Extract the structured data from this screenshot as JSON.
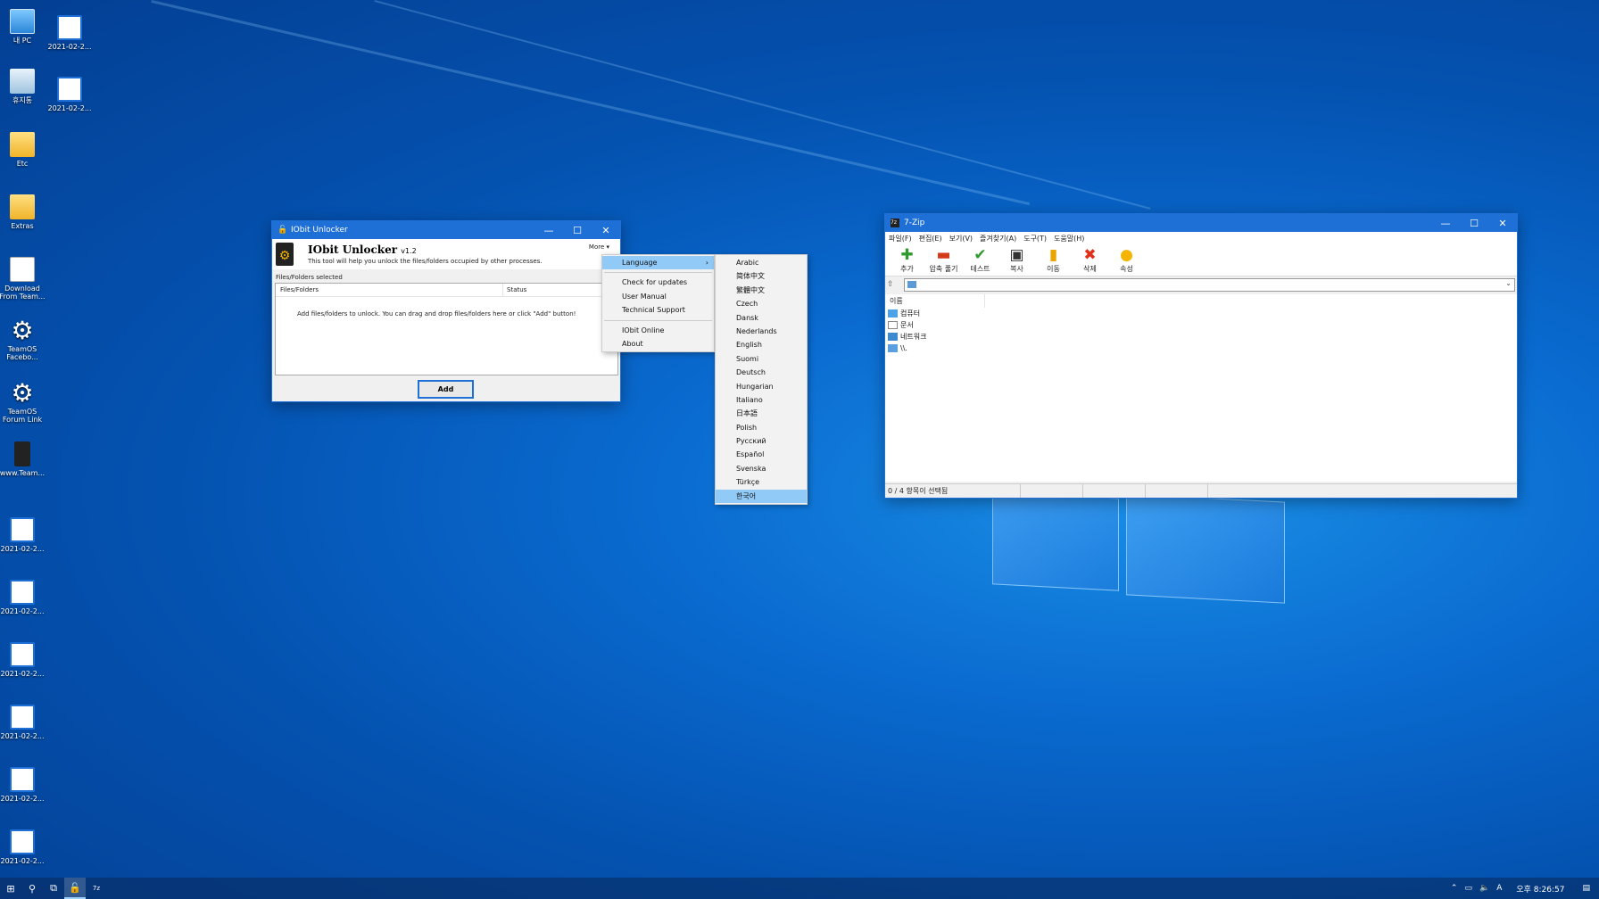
{
  "desktop": {
    "icons": [
      {
        "label": "내 PC",
        "glyph": "pc"
      },
      {
        "label": "2021-02-2...",
        "glyph": "img"
      },
      {
        "label": "휴지통",
        "glyph": "bin"
      },
      {
        "label": "2021-02-2...",
        "glyph": "img"
      },
      {
        "label": "Etc",
        "glyph": "folder"
      },
      {
        "label": "Extras",
        "glyph": "folder"
      },
      {
        "label": "Download From Team...",
        "glyph": "doc"
      },
      {
        "label": "TeamOS Facebo...",
        "glyph": "gear"
      },
      {
        "label": "TeamOS Forum Link",
        "glyph": "gear"
      },
      {
        "label": "www.Team...",
        "glyph": "dark"
      },
      {
        "label": "2021-02-2...",
        "glyph": "img"
      },
      {
        "label": "2021-02-2...",
        "glyph": "img"
      },
      {
        "label": "2021-02-2...",
        "glyph": "img"
      },
      {
        "label": "2021-02-2...",
        "glyph": "img"
      },
      {
        "label": "2021-02-2...",
        "glyph": "img"
      },
      {
        "label": "2021-02-2...",
        "glyph": "img"
      }
    ]
  },
  "iobit": {
    "title": "IObit Unlocker",
    "app_name": "IObit Unlocker",
    "version": "v1.2",
    "subtitle": "This tool will help you unlock the files/folders occupied by other processes.",
    "more_label": "More ▾",
    "selected_label": "Files/Folders selected",
    "col_files": "Files/Folders",
    "col_status": "Status",
    "hint": "Add files/folders to unlock. You can drag and drop files/folders here or click \"Add\" button!",
    "add_button": "Add"
  },
  "more_menu": {
    "language": "Language",
    "check_updates": "Check for updates",
    "user_manual": "User Manual",
    "tech_support": "Technical Support",
    "iobit_online": "IObit Online",
    "about": "About"
  },
  "language_menu": {
    "items": [
      "Arabic",
      "简体中文",
      "繁體中文",
      "Czech",
      "Dansk",
      "Nederlands",
      "English",
      "Suomi",
      "Deutsch",
      "Hungarian",
      "Italiano",
      "日本語",
      "Polish",
      "Русский",
      "Español",
      "Svenska",
      "Türkçe",
      "한국어"
    ],
    "selected": "한국어"
  },
  "sevenzip": {
    "title": "7-Zip",
    "menu": [
      "파일(F)",
      "편집(E)",
      "보기(V)",
      "즐겨찾기(A)",
      "도구(T)",
      "도움말(H)"
    ],
    "toolbar": [
      {
        "label": "추가",
        "icon": "plus-icon",
        "glyph": "✚",
        "color": "#2e9a2e"
      },
      {
        "label": "압축 풀기",
        "icon": "minus-icon",
        "glyph": "▬",
        "color": "#d43a1a"
      },
      {
        "label": "테스트",
        "icon": "check-icon",
        "glyph": "✔",
        "color": "#2e9a2e"
      },
      {
        "label": "복사",
        "icon": "floppy-icon",
        "glyph": "💾",
        "color": "#333333"
      },
      {
        "label": "이동",
        "icon": "move-icon",
        "glyph": "▮",
        "color": "#e9a400"
      },
      {
        "label": "삭제",
        "icon": "delete-icon",
        "glyph": "✖",
        "color": "#e0321a"
      },
      {
        "label": "속성",
        "icon": "bulb-icon",
        "glyph": "💡",
        "color": "#f5b400"
      }
    ],
    "column_name": "이름",
    "rows": [
      {
        "name": "컴퓨터",
        "icon": "pc"
      },
      {
        "name": "문서",
        "icon": "doc"
      },
      {
        "name": "네트워크",
        "icon": "net"
      },
      {
        "name": "\\\\.",
        "icon": "lnk"
      }
    ],
    "status": "0 / 4 항목이 선택됨"
  },
  "taskbar": {
    "clock": "오후 8:26:57",
    "ime": "A"
  }
}
